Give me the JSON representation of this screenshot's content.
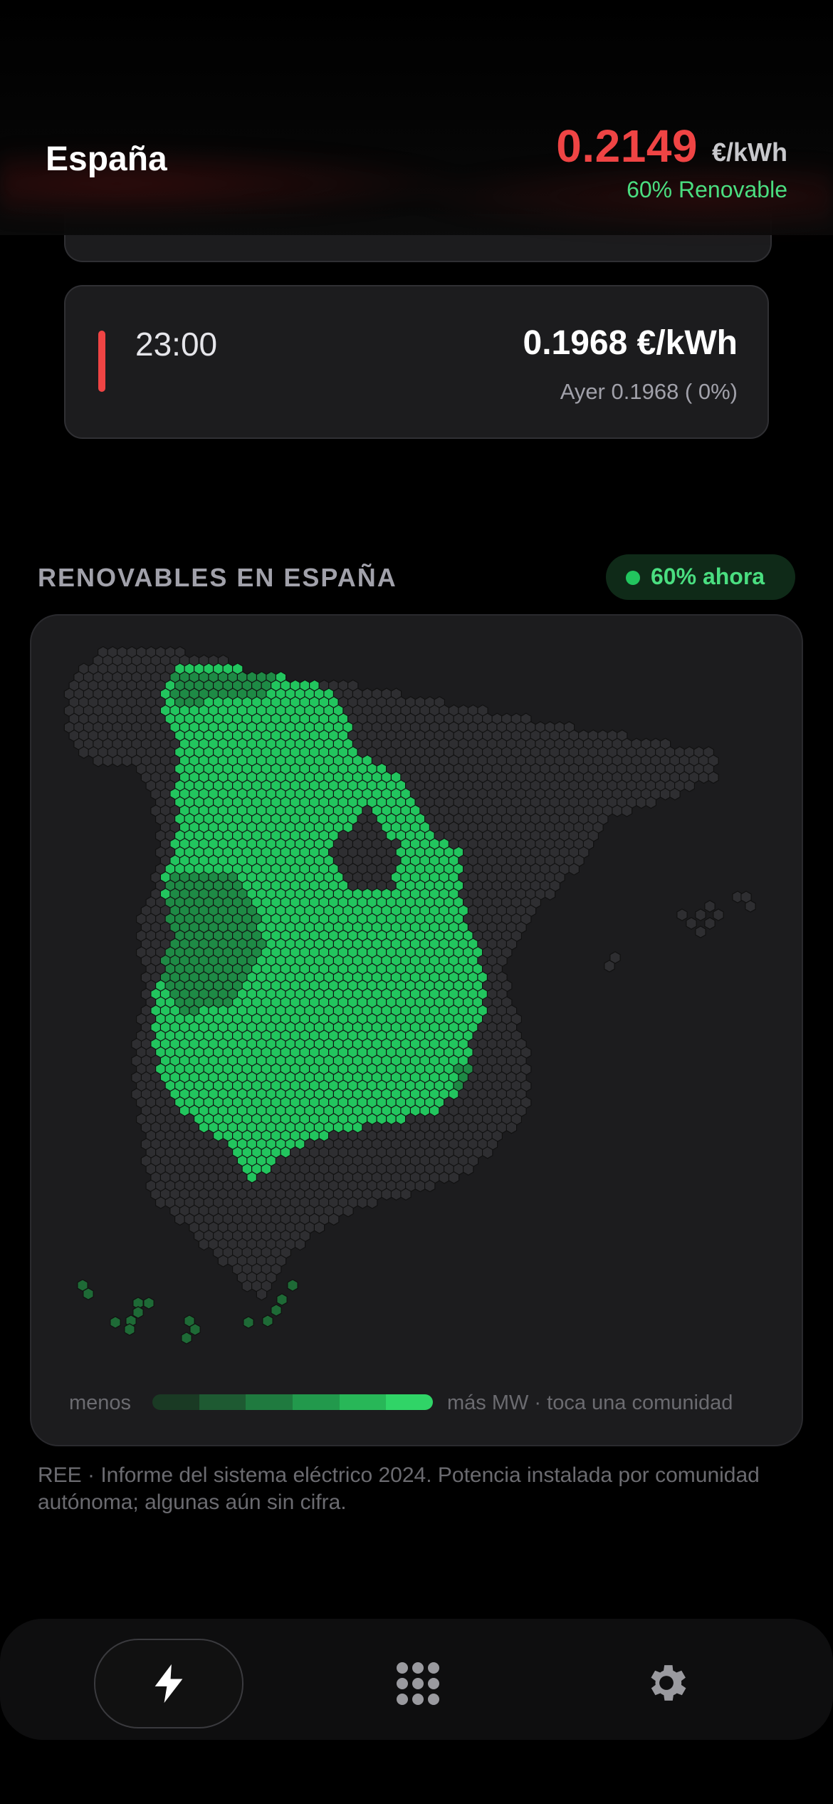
{
  "header": {
    "region": "España",
    "price": "0.2149",
    "unit": "€/kWh",
    "renewable": "60% Renovable"
  },
  "hour_card": {
    "time": "23:00",
    "price": "0.1968 €/kWh",
    "yesterday": "Ayer 0.1968  ( 0%)",
    "indicator_color": "#ef4444"
  },
  "renewables": {
    "section_title": "RENOVABLES EN ESPAÑA",
    "now_badge": "60% ahora",
    "legend_less": "menos",
    "legend_more": "más MW · toca una comunidad",
    "legend_colors": [
      "#1a3a24",
      "#1e5a32",
      "#1f7a3f",
      "#22994c",
      "#28b758",
      "#30d467"
    ],
    "note": "REE · Informe del sistema eléctrico 2024. Potencia instalada por comunidad autónoma; algunas aún sin cifra."
  },
  "colors": {
    "accent_red": "#ef4444",
    "accent_green": "#4ade80",
    "map_bright": "#22c55e",
    "map_mid": "#1e8a45",
    "map_inactive": "#2e2e31"
  },
  "tabs": [
    {
      "icon": "bolt-icon",
      "active": true
    },
    {
      "icon": "grid-icon",
      "active": false
    },
    {
      "icon": "gear-icon",
      "active": false
    }
  ]
}
